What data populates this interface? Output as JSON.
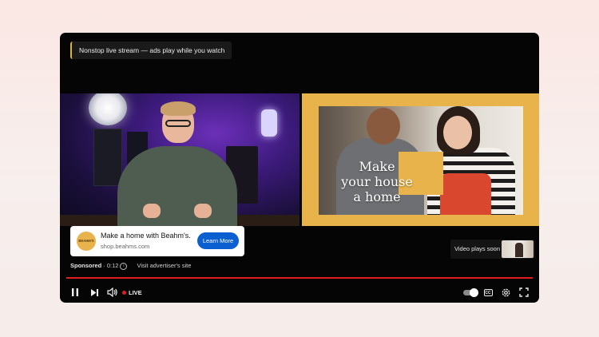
{
  "player": {
    "stream_banner": "Nonstop live stream — ads play while you watch"
  },
  "ad_creative": {
    "headline_lines": [
      "Make",
      "your house",
      "a home"
    ],
    "accent_color": "#e8b34a"
  },
  "sponsor_card": {
    "logo_text": "BEAHM'S",
    "title": "Make a home with Beahm's.",
    "url": "shop.beahms.com",
    "cta_label": "Learn More",
    "cta_color": "#0b5fd0"
  },
  "sponsored_row": {
    "label": "Sponsored",
    "separator": " · ",
    "timer": "0:12",
    "info_icon": "info-icon",
    "visit_link": "Visit advertiser's site"
  },
  "up_next": {
    "label": "Video plays soon"
  },
  "progress": {
    "fraction_played": 1.0,
    "color": "#e11d1d"
  },
  "controls": {
    "live_label": "LIVE",
    "cc_label": "CC",
    "icons": [
      "pause-icon",
      "next-icon",
      "volume-icon",
      "autoplay-toggle",
      "cc-icon",
      "settings-icon",
      "fullscreen-icon"
    ]
  }
}
